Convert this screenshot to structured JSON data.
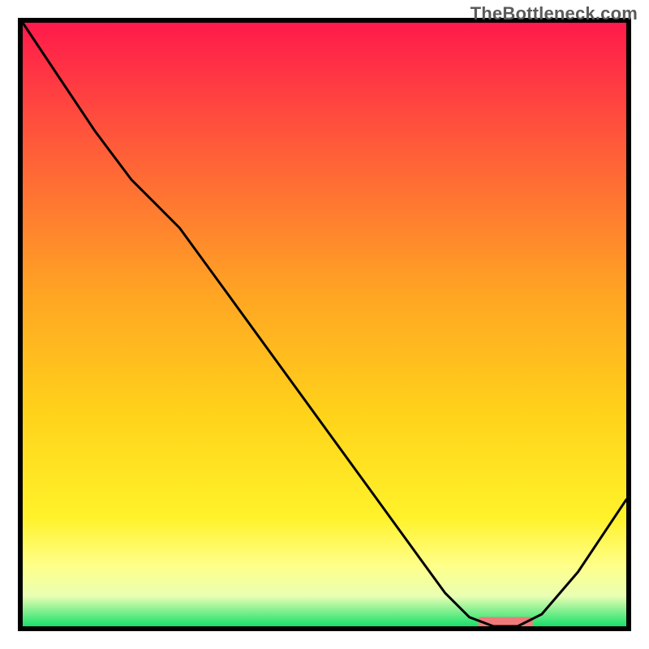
{
  "watermark": "TheBottleneck.com",
  "chart_data": {
    "type": "line",
    "title": "",
    "xlabel": "",
    "ylabel": "",
    "xlim": [
      0,
      100
    ],
    "ylim": [
      0,
      100
    ],
    "grid": false,
    "legend": false,
    "background_gradient": {
      "stops": [
        {
          "offset": 0.0,
          "color": "#ff1a4b"
        },
        {
          "offset": 0.2,
          "color": "#ff5a3a"
        },
        {
          "offset": 0.45,
          "color": "#ffa523"
        },
        {
          "offset": 0.65,
          "color": "#ffd31a"
        },
        {
          "offset": 0.82,
          "color": "#fff22a"
        },
        {
          "offset": 0.9,
          "color": "#ffff8a"
        },
        {
          "offset": 0.95,
          "color": "#e9ffb3"
        },
        {
          "offset": 1.0,
          "color": "#18e06a"
        }
      ]
    },
    "series": [
      {
        "name": "bottleneck-curve",
        "color": "#000000",
        "stroke_width": 3,
        "x": [
          0.0,
          6.0,
          12.0,
          18.0,
          22.0,
          26.0,
          34.0,
          42.0,
          50.0,
          58.0,
          66.0,
          70.0,
          74.0,
          78.0,
          82.0,
          86.0,
          92.0,
          100.0
        ],
        "y": [
          100.0,
          91.0,
          82.0,
          74.0,
          70.0,
          66.0,
          55.0,
          44.0,
          33.0,
          22.0,
          11.0,
          5.5,
          1.5,
          0.0,
          0.0,
          2.0,
          9.0,
          21.0
        ]
      }
    ],
    "marker": {
      "name": "optimal-band",
      "x_center": 80.0,
      "y": 0.0,
      "width": 9.0,
      "height": 1.8,
      "color": "#ef7a7a",
      "rx": 3
    },
    "frame_color": "#000000",
    "frame_width": 6
  }
}
